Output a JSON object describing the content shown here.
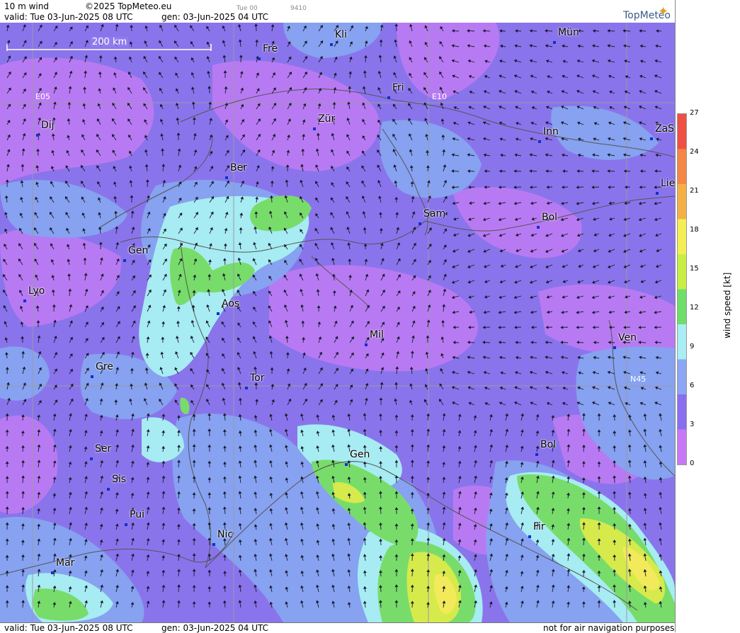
{
  "header": {
    "product": "10 m wind",
    "copyright": "©2025 TopMeteo.eu",
    "run_label": "Tue 00",
    "run_code": "9410",
    "valid": "valid:  Tue  03-Jun-2025  08 UTC",
    "generated": "gen: 03-Jun-2025 04 UTC",
    "brand": "TopMeteo"
  },
  "footer": {
    "valid": "valid:  Tue  03-Jun-2025  08 UTC",
    "generated": "gen: 03-Jun-2025 04 UTC",
    "disclaimer": "not for air navigation purposes"
  },
  "map": {
    "scale_label": "200 km",
    "grid_labels": [
      "E05",
      "E10",
      "N45"
    ],
    "cities": [
      {
        "name": "Kli"
      },
      {
        "name": "Mün"
      },
      {
        "name": "Fre"
      },
      {
        "name": "Fri"
      },
      {
        "name": "Dij"
      },
      {
        "name": "Zür"
      },
      {
        "name": "Inn"
      },
      {
        "name": "ZaS"
      },
      {
        "name": "Ber"
      },
      {
        "name": "Lie"
      },
      {
        "name": "Sam"
      },
      {
        "name": "Bol"
      },
      {
        "name": "Gen"
      },
      {
        "name": "Lyo"
      },
      {
        "name": "Aos"
      },
      {
        "name": "Mil"
      },
      {
        "name": "Ven"
      },
      {
        "name": "Gre"
      },
      {
        "name": "Tor"
      },
      {
        "name": "Ser"
      },
      {
        "name": "Gen"
      },
      {
        "name": "Bol"
      },
      {
        "name": "Sis"
      },
      {
        "name": "Pui"
      },
      {
        "name": "Nic"
      },
      {
        "name": "Fir"
      },
      {
        "name": "Mar"
      }
    ]
  },
  "legend": {
    "title": "wind speed [kt]",
    "unit": "kt",
    "ticks": [
      "0",
      "3",
      "6",
      "9",
      "12",
      "15",
      "18",
      "21",
      "24",
      "27"
    ],
    "colors": [
      "#c878f6",
      "#8a6ef0",
      "#8aa6f4",
      "#a8eef4",
      "#6ede6a",
      "#c8ee46",
      "#f4ee56",
      "#f4b046",
      "#f48646",
      "#ee5046"
    ]
  },
  "colors": {
    "calm": "#b87af2",
    "light": "#8a74ec",
    "moderate": "#86a2f0",
    "fresh": "#a6ecf2",
    "strong": "#78dc6a",
    "stronger": "#d6ea4c",
    "peak": "#f2ea5a"
  }
}
